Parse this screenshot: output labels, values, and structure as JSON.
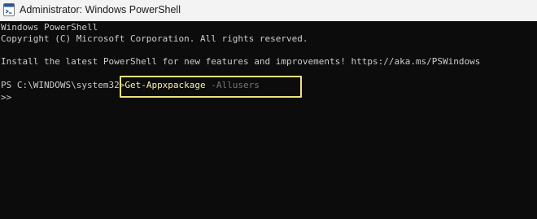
{
  "window": {
    "title": "Administrator: Windows PowerShell",
    "icon": "powershell-icon"
  },
  "console": {
    "line1": "Windows PowerShell",
    "line2": "Copyright (C) Microsoft Corporation. All rights reserved.",
    "line4": "Install the latest PowerShell for new features and improvements! https://aka.ms/PSWindows",
    "prompt": "PS C:\\WINDOWS\\system32>",
    "command": "Get-Appxpackage",
    "parameter": "-Allusers",
    "continuation": ">>"
  },
  "colors": {
    "background": "#0c0c0c",
    "text": "#cccccc",
    "command": "#f9f1a5",
    "parameter": "#767676",
    "highlight": "#ede37c"
  }
}
